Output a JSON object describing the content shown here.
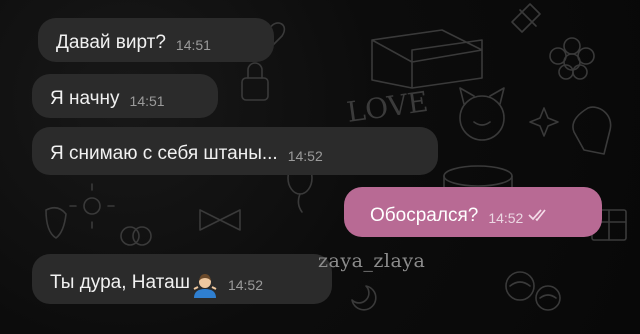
{
  "messages": [
    {
      "text": "Давай вирт?",
      "time": "14:51",
      "direction": "incoming"
    },
    {
      "text": "Я начну",
      "time": "14:51",
      "direction": "incoming"
    },
    {
      "text": "Я снимаю с себя штаны...",
      "time": "14:52",
      "direction": "incoming"
    },
    {
      "text": "Обосрался?",
      "time": "14:52",
      "direction": "outgoing",
      "status": "read"
    },
    {
      "text": "Ты дура, Наташ",
      "time": "14:52",
      "direction": "incoming",
      "emoji": "man-shrugging-emoji"
    }
  ],
  "watermark": "zaya_zlaya",
  "wallpaper_doodle": "LOVE",
  "colors": {
    "background": "#0d0d0d",
    "incoming_bubble": "#2b2b2b",
    "outgoing_bubble": "#b86a94"
  }
}
